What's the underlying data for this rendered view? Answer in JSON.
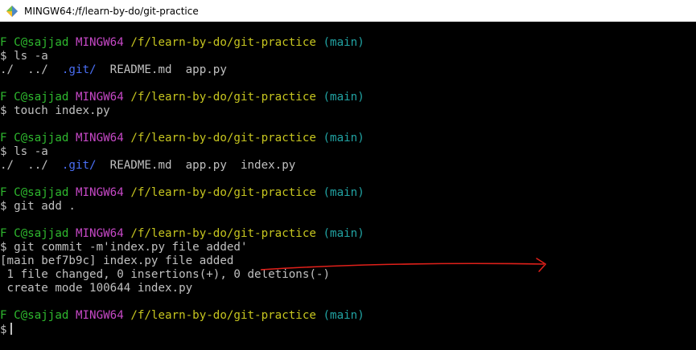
{
  "window": {
    "title": "MINGW64:/f/learn-by-do/git-practice",
    "icon": "git-bash-icon"
  },
  "prompt": {
    "user": "F C@sajjad",
    "host": "MINGW64",
    "path": "/f/learn-by-do/git-practice",
    "branch": "(main)",
    "symbol": "$"
  },
  "commands": [
    {
      "command": "ls -a",
      "output": [
        {
          "parts": [
            {
              "text": "./  ../  ",
              "style": "text"
            },
            {
              "text": ".git/",
              "style": "dir"
            },
            {
              "text": "  README.md  app.py",
              "style": "text"
            }
          ]
        }
      ]
    },
    {
      "command": "touch index.py",
      "output": []
    },
    {
      "command": "ls -a",
      "output": [
        {
          "parts": [
            {
              "text": "./  ../  ",
              "style": "text"
            },
            {
              "text": ".git/",
              "style": "dir"
            },
            {
              "text": "  README.md  app.py  index.py",
              "style": "text"
            }
          ]
        }
      ]
    },
    {
      "command": "git add .",
      "output": []
    },
    {
      "command": "git commit -m'index.py file added'",
      "output": [
        {
          "parts": [
            {
              "text": "[main bef7b9c] index.py file added",
              "style": "text"
            }
          ]
        },
        {
          "parts": [
            {
              "text": " 1 file changed, 0 insertions(+), 0 deletions(-)",
              "style": "text"
            }
          ]
        },
        {
          "parts": [
            {
              "text": " create mode 100644 index.py",
              "style": "text"
            }
          ]
        }
      ]
    }
  ],
  "colors": {
    "background": "#000000",
    "text": "#c0c0c0",
    "user": "#2eb82e",
    "host": "#c648c6",
    "path": "#c6c51f",
    "branch": "#21a3a3",
    "dir": "#4a6ff5",
    "annotation": "#e0201a"
  },
  "annotation": {
    "type": "red-arrow"
  }
}
